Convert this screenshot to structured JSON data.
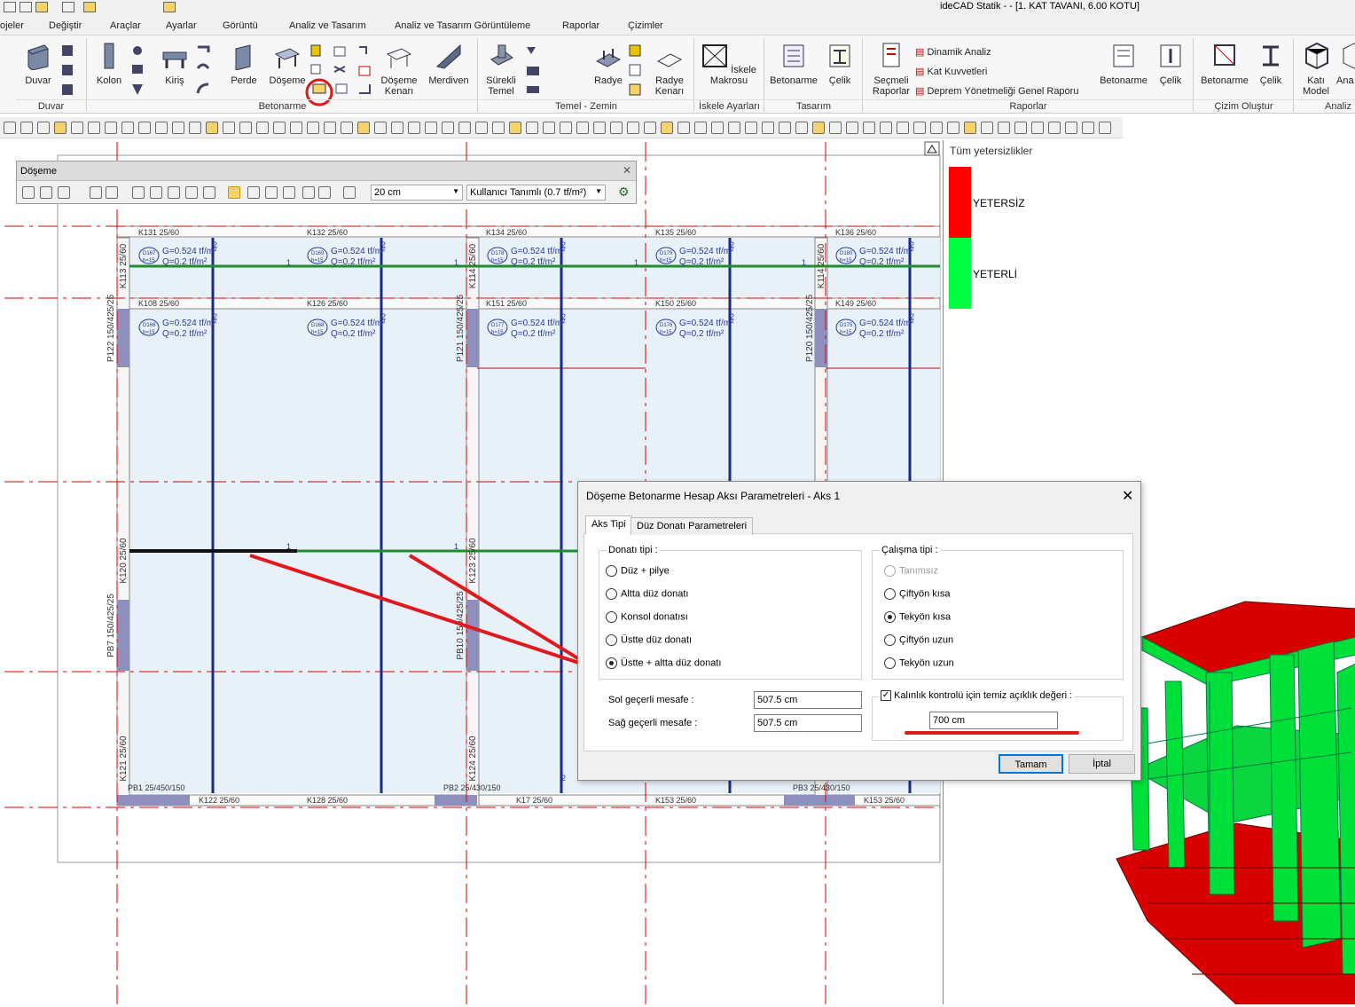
{
  "window": {
    "title": "ideCAD Statik -  - [1. KAT TAVANI,  6.00 KOTU]"
  },
  "menu": [
    "ojeler",
    "Değiştir",
    "Araçlar",
    "Ayarlar",
    "Görüntü",
    "Analiz ve Tasarım",
    "Analiz ve Tasarım Görüntüleme",
    "Raporlar",
    "Çizimler"
  ],
  "ribbon": {
    "groups": {
      "duvar": "Duvar",
      "betonarme": "Betonarme",
      "temel": "Temel - Zemin",
      "iskele": "İskele Ayarları",
      "tasarim": "Tasarım",
      "raporlar": "Raporlar",
      "cizim": "Çizim Oluştur",
      "analiz": "Analiz"
    },
    "buttons": {
      "duvar": "Duvar",
      "kolon": "Kolon",
      "kiris": "Kiriş",
      "perde": "Perde",
      "doseme": "Döşeme",
      "doseme_kenari": "Döşeme Kenarı",
      "merdiven": "Merdiven",
      "surekli_temel": "Sürekli Temel",
      "radye": "Radye",
      "radye_kenari": "Radye Kenarı",
      "iskele_makrosu": "İskele Makrosu",
      "betonarme_t": "Betonarme",
      "celik_t": "Çelik",
      "secmeli_raporlar": "Seçmeli Raporlar",
      "dinamik_analiz": "Dinamik Analiz",
      "kat_kuvvetleri": "Kat Kuvvetleri",
      "deprem": "Deprem Yönetmeliği Genel Raporu",
      "betonarme_r": "Betonarme",
      "celik_r": "Çelik",
      "betonarme_c": "Betonarme",
      "celik_c": "Çelik",
      "kati_model": "Katı Model",
      "ana": "Ana Mo"
    }
  },
  "doseme_toolbar": {
    "title": "Döşeme",
    "thickness": "20 cm",
    "load": "Kullanıcı Tanımlı (0.7 tf/m²)"
  },
  "plan": {
    "beams_top": [
      "K131 25/60",
      "K132 25/60",
      "K134 25/60",
      "K135 25/60",
      "K136 25/60"
    ],
    "beams_mid": [
      "K108 25/60",
      "K126 25/60",
      "K151 25/60",
      "K150 25/60",
      "K149 25/60"
    ],
    "beams_bottom": [
      "K122 25/60",
      "K128 25/60",
      "K17 25/60",
      "K153 25/60",
      "K153 25/60"
    ],
    "slab_top_ids": [
      "D167",
      "D169",
      "D178",
      "D179",
      "D180"
    ],
    "slab_mid_ids": [
      "D166",
      "D168",
      "D177",
      "D176",
      "D175"
    ],
    "slab_h": "h=15",
    "load_g": "G=0.524 tf/m²",
    "load_q": "Q=0.2 tf/m²",
    "vertical_labels": [
      "K113 25/60",
      "P122 150/425/25",
      "K120 25/60",
      "PB7 150/425/25",
      "K121 25/60",
      "K114 25/60",
      "P121 150/425/25",
      "K123 25/60",
      "PB10 150/425/25",
      "K124 25/60",
      "P120 150/425/25",
      "K114 25/60"
    ],
    "bottom_labels": [
      "PB1 25/450/150",
      "PB2 25/430/150",
      "PB3 25/430/150"
    ],
    "marks": {
      "one": "1",
      "two": "2"
    }
  },
  "legend": {
    "title": "Tüm yetersizlikler",
    "items": [
      {
        "label": "YETERSİZ",
        "color": "#ff0000"
      },
      {
        "label": "YETERLİ",
        "color": "#00ff40"
      }
    ]
  },
  "dialog": {
    "title": "Döşeme Betonarme Hesap Aksı Parametreleri - Aks 1",
    "tabs": [
      "Aks Tipi",
      "Düz Donatı Parametreleri"
    ],
    "donati_label": "Donatı tipi :",
    "donati_options": [
      "Düz + pilye",
      "Altta düz donatı",
      "Konsol donatısı",
      "Üstte düz donatı",
      "Üstte + altta düz donatı"
    ],
    "donati_selected": 4,
    "calisma_label": "Çalışma tipi :",
    "calisma_options": [
      "Tanımsız",
      "Çiftyön kısa",
      "Tekyön kısa",
      "Çiftyön uzun",
      "Tekyön uzun"
    ],
    "calisma_selected": 2,
    "sol_label": "Sol geçerli mesafe :",
    "sol_value": "507.5 cm",
    "sag_label": "Sağ geçerli mesafe :",
    "sag_value": "507.5 cm",
    "kalinlik_label": "Kalınlık kontrolü için temiz açıklık değeri :",
    "kalinlik_value": "700 cm",
    "ok": "Tamam",
    "cancel": "İptal"
  },
  "colors": {
    "annotation": "#e0191e",
    "slab_fill": "#e8f0f8",
    "beam_line": "#1a2a8a",
    "green_line": "#1f8c2e"
  }
}
